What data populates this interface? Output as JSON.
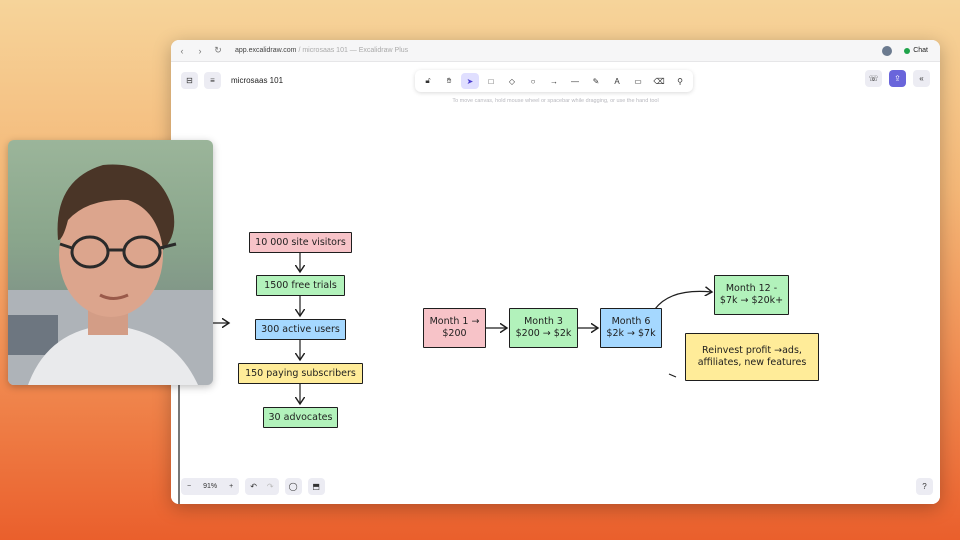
{
  "browser": {
    "url_domain": "app.excalidraw.com",
    "url_rest": "microsaas 101 — Excalidraw Plus",
    "chat_label": "Chat"
  },
  "app": {
    "doc_title": "microsaas 101",
    "hint": "To move canvas, hold mouse wheel or spacebar while dragging, or use the hand tool",
    "zoom": "91%",
    "colors": {
      "accent": "#6965db",
      "pink": "#f7c3c8",
      "green": "#b2f2bb",
      "blue": "#a5d8ff",
      "yellow": "#ffec99"
    }
  },
  "funnel": [
    {
      "label": "10 000 site visitors",
      "color": "pink"
    },
    {
      "label": "1500 free trials",
      "color": "green"
    },
    {
      "label": "300 active users",
      "color": "blue"
    },
    {
      "label": "150 paying subscribers",
      "color": "yellow"
    },
    {
      "label": "30 advocates",
      "color": "green"
    }
  ],
  "timeline": [
    {
      "line1": "Month 1 →",
      "line2": "$200",
      "color": "pink"
    },
    {
      "line1": "Month 3",
      "line2": "$200 → $2k",
      "color": "green"
    },
    {
      "line1": "Month 6",
      "line2": "$2k → $7k",
      "color": "blue"
    },
    {
      "line1": "Month 12 -",
      "line2": "$7k → $20k+",
      "color": "green"
    }
  ],
  "note": {
    "line1": "Reinvest profit →ads,",
    "line2": "affiliates, new features",
    "color": "yellow"
  }
}
